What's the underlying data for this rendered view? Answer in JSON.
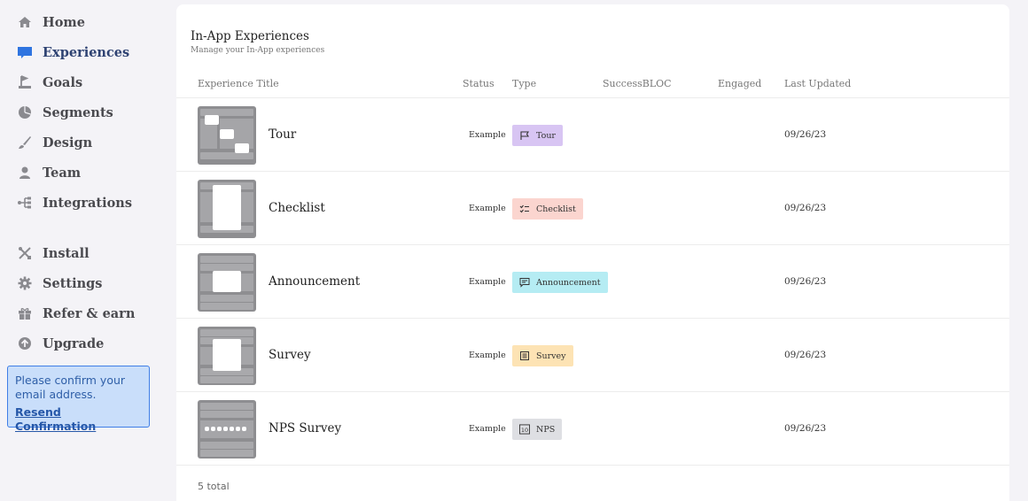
{
  "sidebar": {
    "items": [
      {
        "label": "Home",
        "icon": "home-icon"
      },
      {
        "label": "Experiences",
        "icon": "chat-bubble-icon",
        "active": true
      },
      {
        "label": "Goals",
        "icon": "goal-flag-icon"
      },
      {
        "label": "Segments",
        "icon": "pie-chart-icon"
      },
      {
        "label": "Design",
        "icon": "brush-icon"
      },
      {
        "label": "Team",
        "icon": "user-icon"
      },
      {
        "label": "Integrations",
        "icon": "integrations-icon"
      },
      {
        "label": "Install",
        "icon": "tools-icon"
      },
      {
        "label": "Settings",
        "icon": "gear-icon"
      },
      {
        "label": "Refer & earn",
        "icon": "gift-icon"
      },
      {
        "label": "Upgrade",
        "icon": "upgrade-arrow-icon"
      }
    ]
  },
  "notice": {
    "text": "Please confirm your email address.",
    "link": "Resend Confirmation"
  },
  "main": {
    "title": "In-App Experiences",
    "subtitle": "Manage your In-App experiences",
    "columns": [
      "Experience Title",
      "Status",
      "Type",
      "SuccessBLOC",
      "Engaged",
      "Last Updated"
    ],
    "rows": [
      {
        "title": "Tour",
        "status": "Example",
        "type": "Tour",
        "icon": "flag-icon",
        "color": "#d8c5f3",
        "updated": "09/26/23"
      },
      {
        "title": "Checklist",
        "status": "Example",
        "type": "Checklist",
        "icon": "checklist-icon",
        "color": "#fbd5cf",
        "updated": "09/26/23"
      },
      {
        "title": "Announcement",
        "status": "Example",
        "type": "Announcement",
        "icon": "message-icon",
        "color": "#b5ecf3",
        "updated": "09/26/23"
      },
      {
        "title": "Survey",
        "status": "Example",
        "type": "Survey",
        "icon": "survey-icon",
        "color": "#fde3b4",
        "updated": "09/26/23"
      },
      {
        "title": "NPS Survey",
        "status": "Example",
        "type": "NPS",
        "icon": "nps-icon",
        "color": "#dedfe3",
        "updated": "09/26/23"
      }
    ],
    "total": "5 total"
  },
  "colors": {
    "accent": "#2f74e0",
    "icon_gray": "#8a8a8f",
    "notice_bg": "#c9defa"
  }
}
